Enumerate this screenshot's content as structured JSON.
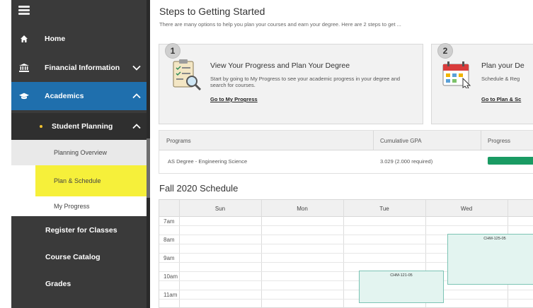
{
  "sidebar": {
    "home": "Home",
    "financial": "Financial Information",
    "academics": "Academics",
    "student_planning": "Student Planning",
    "planning_overview": "Planning Overview",
    "plan_schedule": "Plan & Schedule",
    "my_progress": "My Progress",
    "register": "Register for Classes",
    "catalog": "Course Catalog",
    "grades": "Grades"
  },
  "main": {
    "title": "Steps to Getting Started",
    "subtitle": "There are many options to help you plan your courses and earn your degree. Here are 2 steps to get ...",
    "step1": {
      "number": "1",
      "title": "View Your Progress and Plan Your Degree",
      "desc": "Start by going to My Progress to see your academic progress in your degree and search for courses.",
      "link": "Go to My Progress"
    },
    "step2": {
      "number": "2",
      "title": "Plan your De",
      "desc": "Schedule & Reg",
      "link": "Go to Plan & Sc"
    }
  },
  "programs": {
    "headers": [
      "Programs",
      "Cumulative GPA",
      "Progress"
    ],
    "rows": [
      {
        "program": "AS Degree - Engineering Science",
        "gpa": "3.029 (2.000 required)"
      }
    ]
  },
  "schedule": {
    "title": "Fall 2020 Schedule",
    "days": [
      "Sun",
      "Mon",
      "Tue",
      "Wed"
    ],
    "times": [
      "7am",
      "8am",
      "9am",
      "10am",
      "11am"
    ],
    "events": [
      {
        "label": "CHM-121-05"
      },
      {
        "label": "CHM-125-05"
      }
    ]
  },
  "colors": {
    "sidebar_bg": "#3a3a3a",
    "academics_bg": "#1f6fad",
    "highlight": "#f6f03a",
    "progress": "#1a9b63",
    "event_bg": "#e3f4f0"
  }
}
